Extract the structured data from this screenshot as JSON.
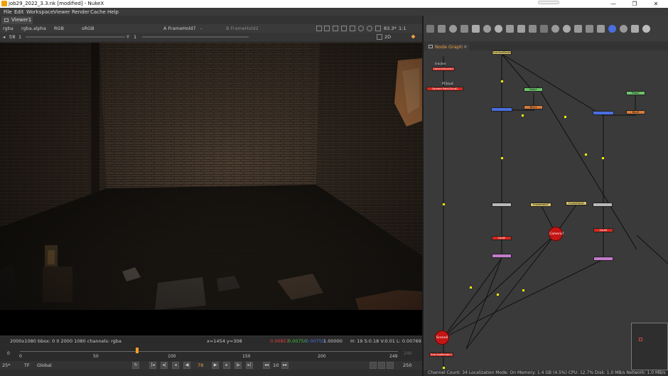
{
  "window": {
    "title": "job29_2022_3.3.nk [modified] - NukeX",
    "minimize": "—",
    "maximize": "❐",
    "close": "✕"
  },
  "menu": [
    "File",
    "Edit",
    "Workspace",
    "Viewer",
    "Render",
    "Cache",
    "Help"
  ],
  "viewer": {
    "tab_label": "Viewer1",
    "channels": "rgba",
    "alpha_channel": "rgba.alpha",
    "display": "RGB",
    "colorspace": "sRGB",
    "input_a": "A  FrameHold7",
    "input_a_op": "-",
    "input_b": "B  FrameHold2",
    "zoom": "83.3*",
    "ratio": "1:1",
    "gain_label": "f/8",
    "gain_value": "1",
    "gamma_label": "Y",
    "gamma_value": "1",
    "view_mode": "2D",
    "info": {
      "format": "2000x1080  bbox: 0 0 2000 1080 channels: rgba",
      "coords": "x=1454 y=308",
      "r": "0.00857",
      "g": "0.00750",
      "b": "0.00750",
      "a": "1.00000",
      "hsvl": "H: 19 S:0.18 V:0.01  L: 0.00769"
    },
    "timeline": {
      "ticks": [
        "0",
        "50",
        "100",
        "150",
        "200",
        "249"
      ],
      "start": "0",
      "end": "249",
      "end_field": "249",
      "current": "78"
    },
    "transport": {
      "fps": "25*",
      "tf": "TF",
      "scope": "Global",
      "frame": "78",
      "step": "10",
      "end_frame": "250"
    }
  },
  "node_graph": {
    "tab_label": "Node Graph",
    "tab_close": "✕",
    "status": "Channel Count: 34  Localization Mode: On  Memory: 1.4 GB (4.5%)  CPU: 12.7%  Disk: 1.0 MB/s  Network: 1.0 MB/s",
    "nodes": {
      "read": "ScanlineRender1",
      "camtracker": "CameraTracker1",
      "pointcloud": "Camera     PointCloud1",
      "roto1": "Roto1",
      "blur1": "Blur1",
      "roto2": "Roto2",
      "blur2": "Blur2",
      "fh7": "FrameHold7",
      "fh2": "FrameHold2",
      "card2": "Card2",
      "card3": "Card3",
      "cam7": "Camera7",
      "scene": "Scene4",
      "scanline": "ScanlineRender1"
    }
  },
  "colors": {
    "node_orange": "#d67a3c",
    "node_green": "#6cc46c",
    "node_blue": "#4a6ee0",
    "node_red": "#d4271f",
    "node_yellow": "#d8c46a",
    "node_pink": "#c47acb",
    "node_gray": "#b9b9b9",
    "pipe": "#101010",
    "dot": "#f2f200",
    "tab_orange": "#e8a044"
  }
}
